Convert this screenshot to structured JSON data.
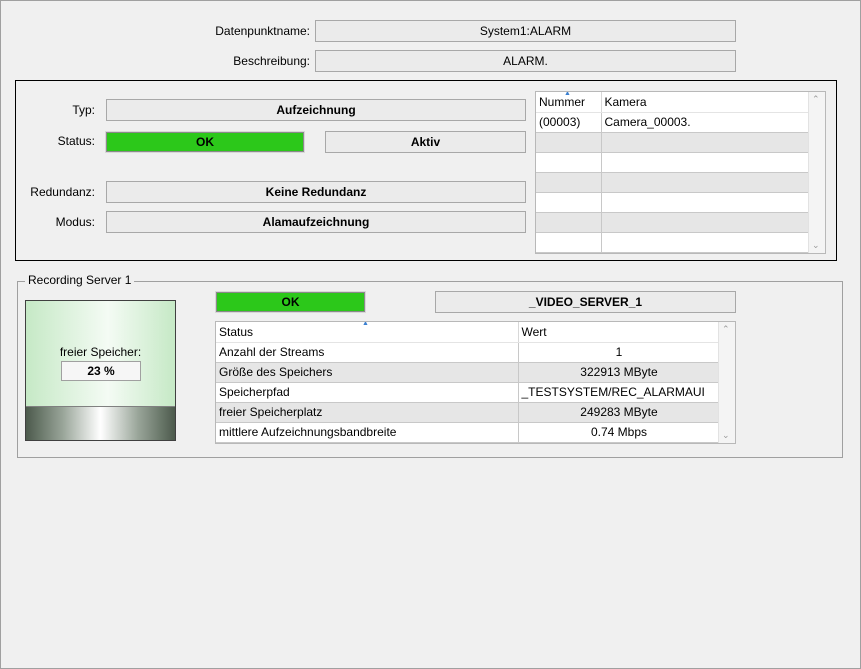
{
  "header": {
    "dp_name_label": "Datenpunktname:",
    "dp_name_value": "System1:ALARM",
    "description_label": "Beschreibung:",
    "description_value": "ALARM."
  },
  "camera_panel": {
    "type_label": "Typ:",
    "type_value": "Aufzeichnung",
    "status_label": "Status:",
    "status_value": "OK",
    "status_color": "#2cc81a",
    "active_value": "Aktiv",
    "redundancy_label": "Redundanz:",
    "redundancy_value": "Keine Redundanz",
    "mode_label": "Modus:",
    "mode_value": "Alamaufzeichnung",
    "table": {
      "columns": [
        "Nummer",
        "Kamera"
      ],
      "rows": [
        [
          "(00003)",
          "Camera_00003."
        ]
      ]
    }
  },
  "recording_server": {
    "group_title": "Recording Server 1",
    "status_value": "OK",
    "server_name": "_VIDEO_SERVER_1",
    "storage_label": "freier Speicher:",
    "storage_percent_text": "23 %",
    "storage_free_fraction": 0.23,
    "table": {
      "columns": [
        "Status",
        "Wert"
      ],
      "rows": [
        [
          "Anzahl der Streams",
          "1"
        ],
        [
          "Größe des Speichers",
          "322913 MByte"
        ],
        [
          "Speicherpfad",
          "_TESTSYSTEM/REC_ALARMAUI"
        ],
        [
          "freier Speicherplatz",
          "249283 MByte"
        ],
        [
          "mittlere Aufzeichnungsbandbreite",
          "0.74 Mbps"
        ]
      ]
    }
  },
  "icons": {
    "sort": "sort-ascending-icon",
    "scroll_up": "scroll-up-icon",
    "scroll_down": "scroll-down-icon"
  }
}
